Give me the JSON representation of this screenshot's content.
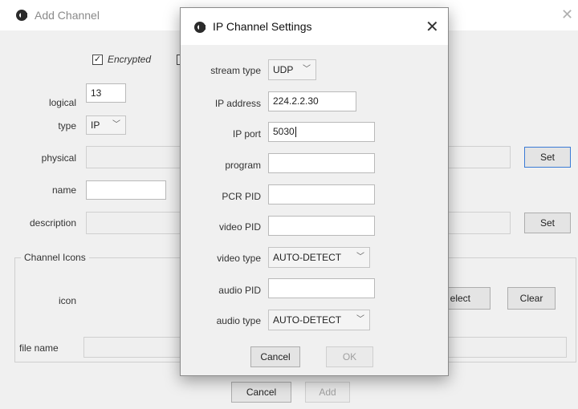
{
  "background_window": {
    "title": "Add Channel",
    "encrypted_label": "Encrypted",
    "encrypted_checked": true,
    "logical_label": "logical",
    "logical_value": "13",
    "type_label": "type",
    "type_value": "IP",
    "physical_label": "physical",
    "physical_set_label": "Set",
    "name_label": "name",
    "description_label": "description",
    "description_set_label": "Set",
    "icons_group_label": "Channel Icons",
    "icon_label": "icon",
    "select_label": "elect",
    "clear_label": "Clear",
    "file_name_label": "file name",
    "cancel_label": "Cancel",
    "add_label": "Add"
  },
  "dialog": {
    "title": "IP Channel Settings",
    "stream_type_label": "stream type",
    "stream_type_value": "UDP",
    "ip_address_label": "IP address",
    "ip_address_value": "224.2.2.30",
    "ip_port_label": "IP port",
    "ip_port_value": "5030",
    "program_label": "program",
    "program_value": "",
    "pcr_pid_label": "PCR PID",
    "pcr_pid_value": "",
    "video_pid_label": "video PID",
    "video_pid_value": "",
    "video_type_label": "video type",
    "video_type_value": "AUTO-DETECT",
    "audio_pid_label": "audio PID",
    "audio_pid_value": "",
    "audio_type_label": "audio type",
    "audio_type_value": "AUTO-DETECT",
    "cancel_label": "Cancel",
    "ok_label": "OK"
  },
  "icons": {
    "app_icon": "app-logo-icon",
    "close_icon": "close-x-icon",
    "chevron": "chevron-down-icon",
    "check": "checkmark-icon"
  }
}
